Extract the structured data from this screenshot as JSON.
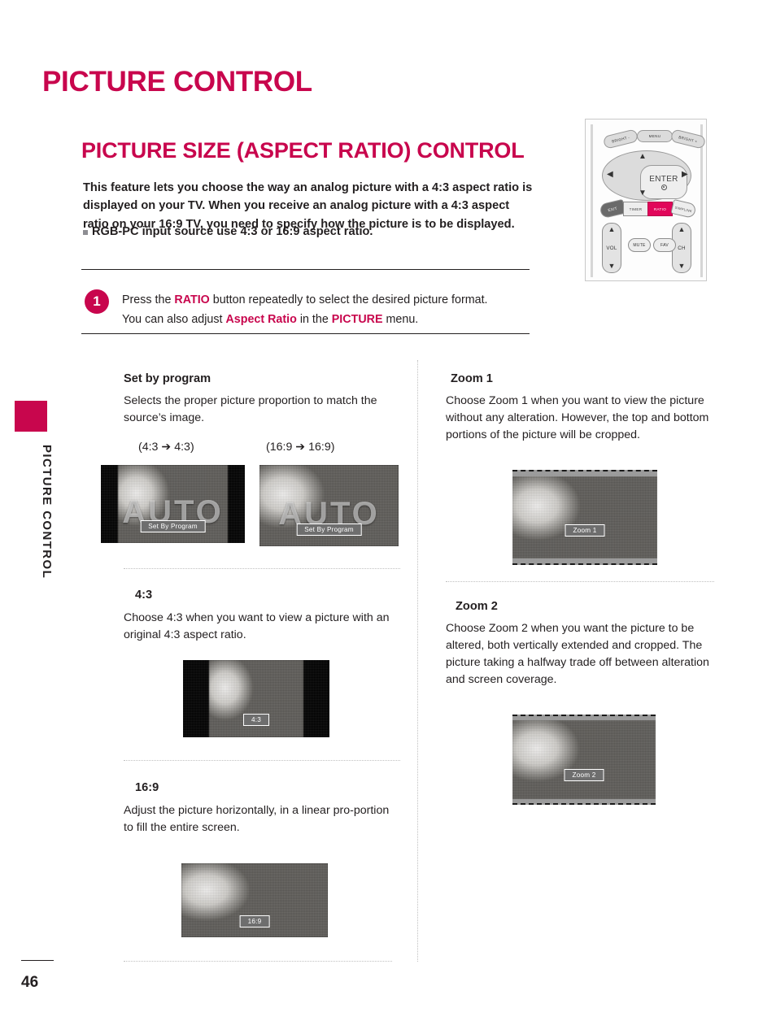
{
  "page": {
    "number": "46",
    "chapter_title": "PICTURE CONTROL",
    "side_tab_label": "PICTURE CONTROL",
    "accent_color": "#c8064d"
  },
  "section": {
    "title": "PICTURE SIZE (ASPECT RATIO) CONTROL",
    "intro": "This feature lets you choose the way an analog picture with a 4:3 aspect ratio is displayed on your TV. When you receive an analog picture with a 4:3 aspect ratio on your 16:9 TV, you need to specify how the picture is to be displayed.",
    "bullet": "RGB-PC input source use 4:3 or 16:9 aspect ratio."
  },
  "step": {
    "number": "1",
    "line1_a": "Press the ",
    "line1_kw": "RATIO",
    "line1_b": " button repeatedly to select the desired picture format.",
    "line2_a": "You can also adjust ",
    "line2_kw1": "Aspect Ratio",
    "line2_b": " in the ",
    "line2_kw2": "PICTURE",
    "line2_c": " menu."
  },
  "remote": {
    "bright_minus": "BRIGHT -",
    "menu": "MENU",
    "bright_plus": "BRIGHT +",
    "enter": "ENTER",
    "arrow_up": "▲",
    "arrow_down": "▼",
    "arrow_left": "◀",
    "arrow_right": "▶",
    "exit": "EXIT",
    "timer": "TIMER",
    "ratio": "RATIO",
    "simplink": "SIMPLINK",
    "vol": "VOL",
    "ch": "CH",
    "mute": "MUTE",
    "fav": "FAV",
    "ratio_highlight_color": "#e1065a"
  },
  "left_column": {
    "set_by_program": {
      "title": "Set by program",
      "body": "Selects the proper picture proportion to match the source’s image.",
      "caption_left": "(4:3 ➔ 4:3)",
      "caption_right": "(16:9 ➔ 16:9)",
      "osd_left": "Set By Program",
      "osd_right": "Set By Program",
      "screen_word": "AUTO"
    },
    "four_three": {
      "title": "4:3",
      "body": "Choose 4:3 when you want to view a picture with an original 4:3 aspect ratio.",
      "osd": "4:3"
    },
    "sixteen_nine": {
      "title": "16:9",
      "body": "Adjust the picture horizontally, in a linear pro-portion to fill the entire screen.",
      "osd": "16:9"
    }
  },
  "right_column": {
    "zoom1": {
      "title": "Zoom 1",
      "body": "Choose Zoom 1 when you want to view the picture without any alteration. However, the top and bottom portions of the picture will be cropped.",
      "osd": "Zoom 1"
    },
    "zoom2": {
      "title": "Zoom 2",
      "body": "Choose Zoom 2 when you want the picture to be altered, both vertically extended and cropped. The picture taking a halfway trade off between alteration and screen coverage.",
      "osd": "Zoom 2"
    }
  }
}
